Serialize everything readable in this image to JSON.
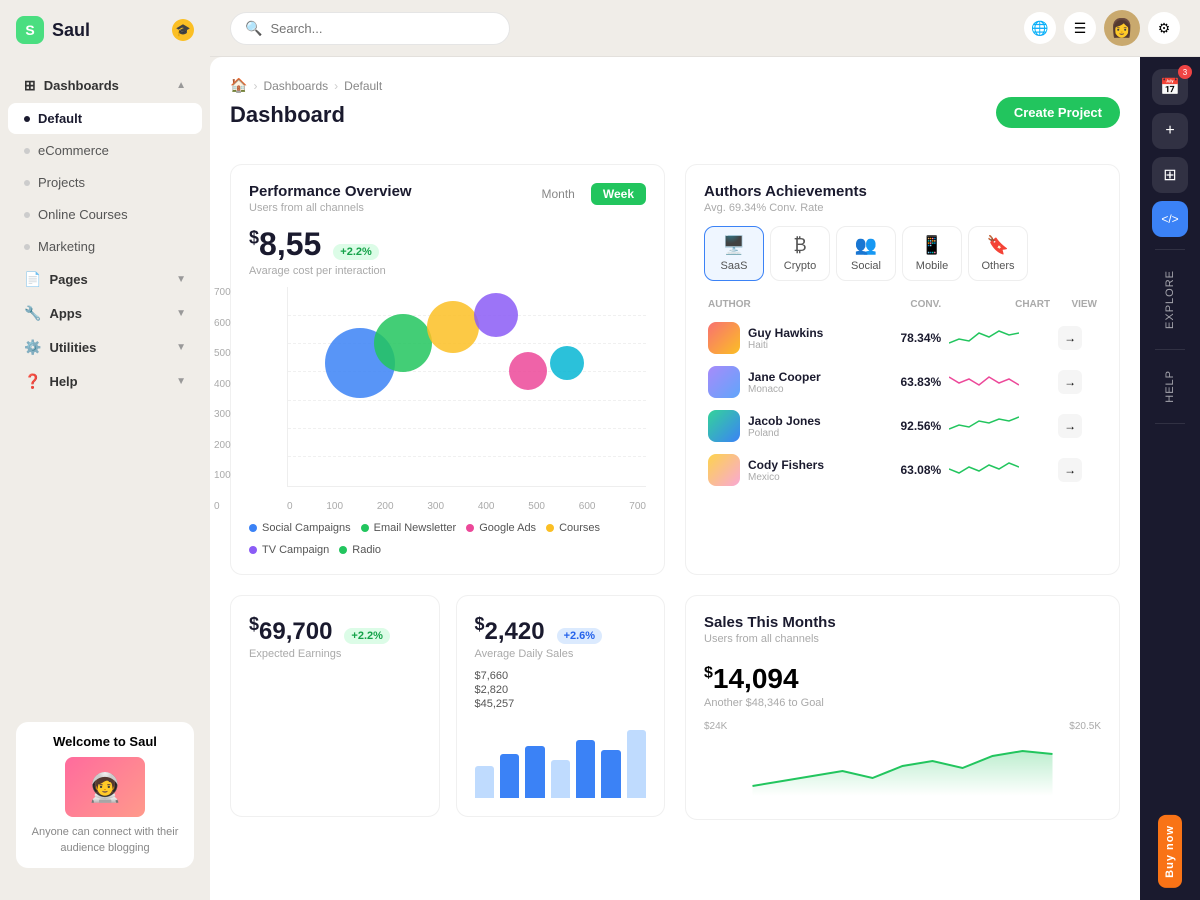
{
  "app": {
    "name": "Saul",
    "logo_letter": "S"
  },
  "topbar": {
    "search_placeholder": "Search...",
    "create_button": "Create Project"
  },
  "breadcrumb": {
    "home": "🏠",
    "section": "Dashboards",
    "page": "Default"
  },
  "page_title": "Dashboard",
  "sidebar": {
    "items": [
      {
        "label": "Dashboards",
        "has_arrow": true,
        "has_grid_icon": true
      },
      {
        "label": "Default",
        "is_active": true
      },
      {
        "label": "eCommerce"
      },
      {
        "label": "Projects"
      },
      {
        "label": "Online Courses"
      },
      {
        "label": "Marketing"
      },
      {
        "label": "Pages",
        "has_arrow": true
      },
      {
        "label": "Apps",
        "has_arrow": true
      },
      {
        "label": "Utilities",
        "has_arrow": true
      },
      {
        "label": "Help",
        "has_arrow": true
      }
    ],
    "welcome": {
      "title": "Welcome to Saul",
      "subtitle": "Anyone can connect with their audience blogging"
    }
  },
  "performance": {
    "title": "Performance Overview",
    "subtitle": "Users from all channels",
    "tabs": [
      "Month",
      "Week"
    ],
    "active_tab": "Week",
    "value": "8,55",
    "value_prefix": "$",
    "badge": "+2.2%",
    "value_label": "Avarage cost per interaction",
    "y_labels": [
      "700",
      "600",
      "500",
      "400",
      "300",
      "200",
      "100",
      "0"
    ],
    "x_labels": [
      "0",
      "100",
      "200",
      "300",
      "400",
      "500",
      "600",
      "700"
    ],
    "bubbles": [
      {
        "x": 22,
        "y": 42,
        "size": 70,
        "color": "#3b82f6"
      },
      {
        "x": 32,
        "y": 32,
        "size": 58,
        "color": "#22c55e"
      },
      {
        "x": 44,
        "y": 26,
        "size": 52,
        "color": "#fbbf24"
      },
      {
        "x": 54,
        "y": 22,
        "size": 44,
        "color": "#8b5cf6"
      },
      {
        "x": 61,
        "y": 47,
        "size": 36,
        "color": "#ec4899"
      },
      {
        "x": 72,
        "y": 44,
        "size": 34,
        "color": "#06b6d4"
      }
    ],
    "legend": [
      {
        "label": "Social Campaigns",
        "color": "#3b82f6"
      },
      {
        "label": "Email Newsletter",
        "color": "#22c55e"
      },
      {
        "label": "Google Ads",
        "color": "#ec4899"
      },
      {
        "label": "Courses",
        "color": "#fbbf24"
      },
      {
        "label": "TV Campaign",
        "color": "#8b5cf6"
      },
      {
        "label": "Radio",
        "color": "#22c55e"
      }
    ]
  },
  "authors": {
    "title": "Authors Achievements",
    "subtitle": "Avg. 69.34% Conv. Rate",
    "tabs": [
      {
        "label": "SaaS",
        "icon": "🖥️",
        "active": true
      },
      {
        "label": "Crypto",
        "icon": "₿"
      },
      {
        "label": "Social",
        "icon": "👥"
      },
      {
        "label": "Mobile",
        "icon": "📱"
      },
      {
        "label": "Others",
        "icon": "🔖"
      }
    ],
    "columns": {
      "author": "AUTHOR",
      "conv": "CONV.",
      "chart": "CHART",
      "view": "VIEW"
    },
    "rows": [
      {
        "name": "Guy Hawkins",
        "location": "Haiti",
        "conv": "78.34%",
        "chart_color": "#22c55e",
        "av_class": "av-1"
      },
      {
        "name": "Jane Cooper",
        "location": "Monaco",
        "conv": "63.83%",
        "chart_color": "#ec4899",
        "av_class": "av-2"
      },
      {
        "name": "Jacob Jones",
        "location": "Poland",
        "conv": "92.56%",
        "chart_color": "#22c55e",
        "av_class": "av-3"
      },
      {
        "name": "Cody Fishers",
        "location": "Mexico",
        "conv": "63.08%",
        "chart_color": "#22c55e",
        "av_class": "av-4"
      }
    ]
  },
  "earnings": {
    "value": "69,700",
    "value_prefix": "$",
    "badge": "+2.2%",
    "label": "Expected Earnings"
  },
  "daily_sales": {
    "value": "2,420",
    "value_prefix": "$",
    "badge": "+2.6%",
    "label": "Average Daily Sales",
    "rows": [
      {
        "label": "$7,660"
      },
      {
        "label": "$2,820"
      },
      {
        "label": "$45,257"
      }
    ]
  },
  "sales_month": {
    "title": "Sales This Months",
    "subtitle": "Users from all channels",
    "amount": "14,094",
    "amount_prefix": "$",
    "goal_text": "Another $48,346 to Goal",
    "y_labels": [
      "$24K",
      "$20.5K"
    ]
  },
  "right_sidebar": {
    "icons": [
      "📅",
      "+",
      "⊞",
      "</>"
    ],
    "labels": [
      "Explore",
      "Help"
    ],
    "buy_label": "Buy now"
  }
}
